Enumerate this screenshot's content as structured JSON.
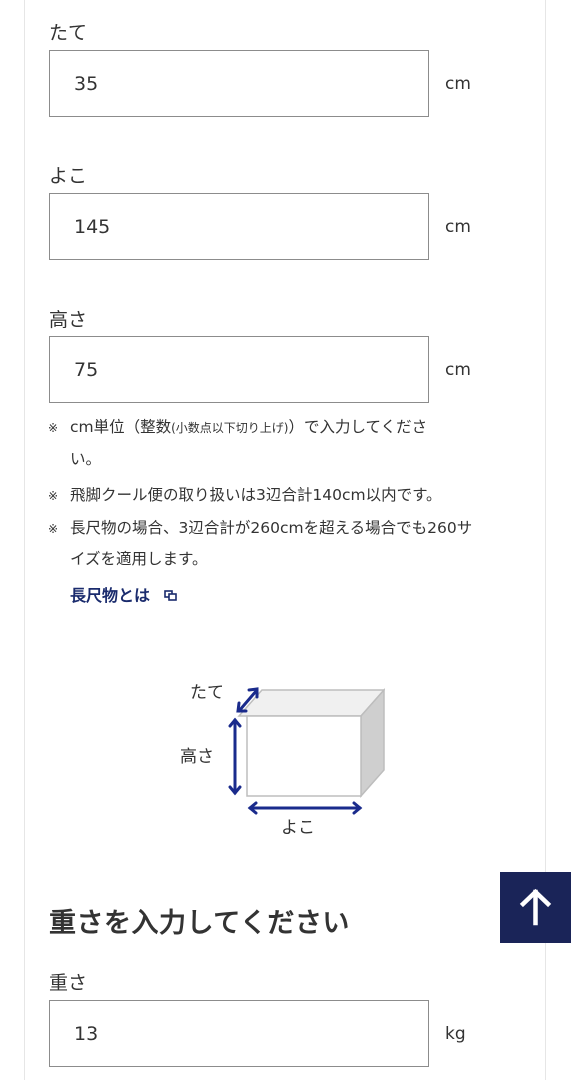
{
  "dimensions": {
    "depth": {
      "label": "たて",
      "value": "35",
      "unit": "cm"
    },
    "width": {
      "label": "よこ",
      "value": "145",
      "unit": "cm"
    },
    "height": {
      "label": "高さ",
      "value": "75",
      "unit": "cm"
    }
  },
  "notes": {
    "mark": "※",
    "note1_a": "cm単位（整数",
    "note1_sub": "(小数点以下切り上げ)",
    "note1_b": "）で入力してくださ",
    "note1_cont": "い。",
    "note2": "飛脚クール便の取り扱いは3辺合計140cm以内です。",
    "note3": "長尺物の場合、3辺合計が260cmを超える場合でも260サ",
    "note3_cont": "イズを適用します。"
  },
  "link": {
    "label": "長尺物とは",
    "icon": "external-window-icon"
  },
  "diagram": {
    "depth_label": "たて",
    "height_label": "高さ",
    "width_label": "よこ",
    "arrow_color": "#1a2b8c"
  },
  "weight_section": {
    "heading": "重さを入力してください",
    "label": "重さ",
    "value": "13",
    "unit": "kg"
  },
  "back_to_top": {
    "icon": "arrow-up-icon",
    "bg_color": "#1a2458"
  }
}
